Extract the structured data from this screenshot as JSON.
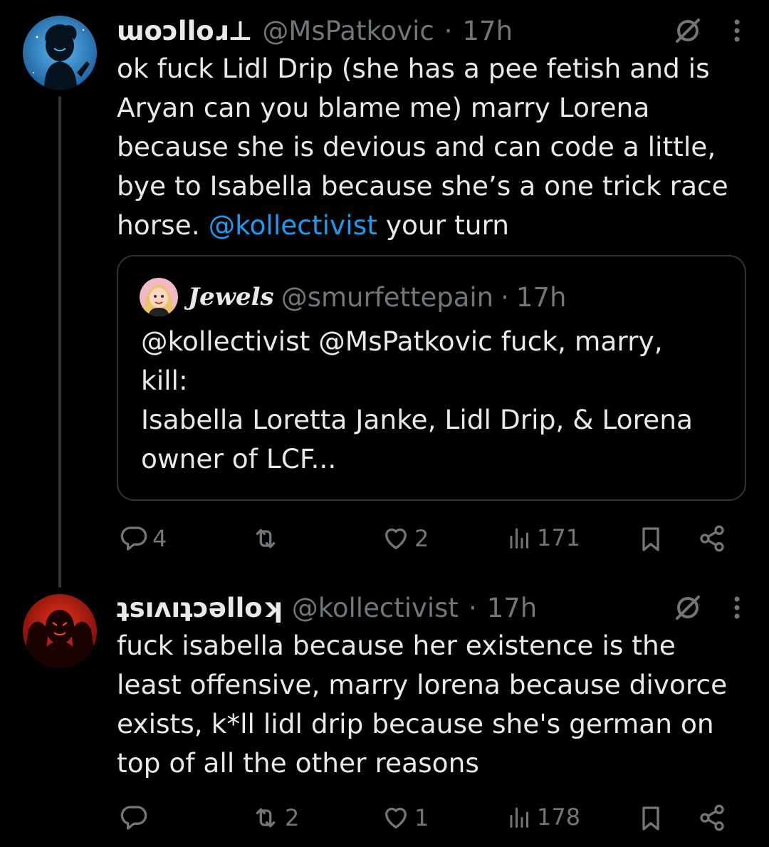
{
  "tweets": [
    {
      "display_name": "ɯoɔlloɹ⊥",
      "handle": "@MsPatkovic",
      "separator": "·",
      "time": "17h",
      "body_before": "ok fuck Lidl Drip (she has a pee fetish and is\nAryan can you blame me) marry Lorena\nbecause she is devious and can code a little,\nbye to Isabella because she’s a one trick race\nhorse. ",
      "mention": "@kollectivist",
      "body_after": " your turn",
      "quote": {
        "display_name": "Jewels",
        "handle": "@smurfettepain",
        "separator": "·",
        "time": "17h",
        "body": "@kollectivist @MsPatkovic fuck, marry,\nkill:\nIsabella Loretta Janke, Lidl Drip, & Lorena\nowner of LCF..."
      },
      "stats": {
        "replies": "4",
        "reposts": "",
        "likes": "2",
        "views": "171"
      },
      "avatar_color": "#2f8fd3"
    },
    {
      "display_name": "ʇsıʌıʇɔǝlloʞ",
      "handle": "@kollectivist",
      "separator": "·",
      "time": "17h",
      "body": "fuck isabella because her existence is the\nleast offensive, marry lorena because divorce\nexists, k*ll lidl drip because she's german on\ntop of all the other reasons",
      "stats": {
        "replies": "",
        "reposts": "2",
        "likes": "1",
        "views": "178"
      },
      "avatar_color": "#c4160f"
    }
  ],
  "colors": {
    "background": "#000000",
    "text": "#e7e9ea",
    "secondary": "#71767b",
    "link": "#1d9bf0",
    "border": "#2f3336"
  },
  "icons": [
    "grok-icon",
    "more-icon",
    "reply-icon",
    "repost-icon",
    "like-icon",
    "views-icon",
    "bookmark-icon",
    "share-icon"
  ]
}
